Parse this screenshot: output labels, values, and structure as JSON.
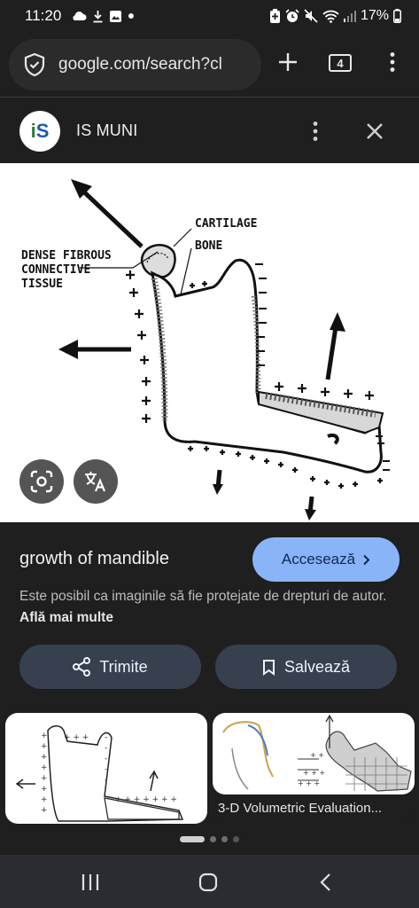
{
  "status_bar": {
    "time": "11:20",
    "battery": "17%",
    "icons": [
      "cloud-icon",
      "download-icon",
      "image-icon",
      "dot-icon",
      "battery-saver-icon",
      "alarm-icon",
      "mute-icon",
      "wifi-icon",
      "signal-icon",
      "battery-icon"
    ]
  },
  "browser": {
    "url": "google.com/search?cl",
    "tab_count": "4",
    "icons": [
      "site-security-icon",
      "new-tab-icon",
      "tabs-icon",
      "more-menu-icon"
    ]
  },
  "source": {
    "logo_text_i": "i",
    "logo_text_s": "S",
    "name": "IS MUNI",
    "icons": [
      "more-options-icon",
      "close-icon"
    ]
  },
  "image": {
    "labels": {
      "cartilage": "CARTILAGE",
      "bone": "BONE",
      "dense_fibrous": "DENSE FIBROUS",
      "connective": "CONNECTIVE",
      "tissue": "TISSUE"
    },
    "icons": [
      "google-lens-icon",
      "translate-icon"
    ]
  },
  "details": {
    "title": "growth of mandible",
    "visit_label": "Accesează",
    "copyright": "Este posibil ca imaginile să fie protejate de drepturi de autor.",
    "learn_more": "Află mai multe",
    "share_label": "Trimite",
    "save_label": "Salvează"
  },
  "related": [
    {
      "caption": ""
    },
    {
      "caption": "3-D Volumetric Evaluation..."
    }
  ],
  "nav_icons": [
    "recent-apps-icon",
    "home-icon",
    "back-icon"
  ]
}
